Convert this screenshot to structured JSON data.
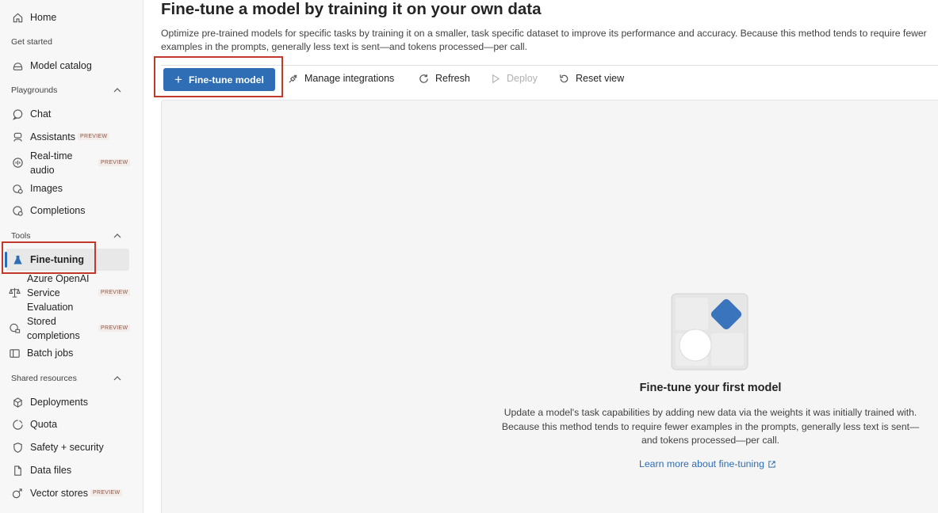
{
  "sidebar": {
    "home": "Home",
    "get_started": "Get started",
    "model_catalog": "Model catalog",
    "playgrounds": "Playgrounds",
    "chat": "Chat",
    "assistants": "Assistants",
    "realtime_line1": "Real-time",
    "realtime_line2": "audio",
    "images": "Images",
    "completions": "Completions",
    "tools": "Tools",
    "fine_tuning": "Fine-tuning",
    "eval_line1": "Azure OpenAI",
    "eval_line2": "Service",
    "eval_line3": "Evaluation",
    "stored_line1": "Stored",
    "stored_line2": "completions",
    "batch_jobs": "Batch jobs",
    "shared_resources": "Shared resources",
    "deployments": "Deployments",
    "quota": "Quota",
    "safety": "Safety + security",
    "data_files": "Data files",
    "vector_stores": "Vector stores",
    "preview_badge": "PREVIEW"
  },
  "main": {
    "title": "Fine-tune a model by training it on your own data",
    "subtitle": "Optimize pre-trained models for specific tasks by training it on a smaller, task specific dataset to improve its performance and accuracy. Because this method tends to require fewer examples in the prompts, generally less text is sent—and tokens processed—per call.",
    "toolbar": {
      "fine_tune": "Fine-tune model",
      "manage_integrations": "Manage integrations",
      "refresh": "Refresh",
      "deploy": "Deploy",
      "reset_view": "Reset view"
    },
    "empty": {
      "title": "Fine-tune your first model",
      "desc_line1": "Update a model's task capabilities by adding new data via the weights it was initially trained with.",
      "desc_line2": "Because this method tends to require fewer examples in the prompts, generally less text is sent—",
      "desc_line3": "and tokens processed—per call.",
      "link": "Learn more about fine-tuning"
    }
  },
  "colors": {
    "accent": "#2f6db4",
    "highlight": "#c0392b",
    "illus_diamond": "#3a74bd"
  },
  "icons": [
    "home-icon",
    "catalog-icon",
    "chevron-up-icon",
    "chat-icon",
    "assistants-icon",
    "audio-icon",
    "images-icon",
    "completions-icon",
    "flask-icon",
    "evaluation-icon",
    "stored-icon",
    "batch-icon",
    "deployments-icon",
    "quota-icon",
    "shield-icon",
    "file-icon",
    "vector-icon",
    "plus-icon",
    "plug-icon",
    "refresh-icon",
    "play-icon",
    "reset-icon",
    "external-link-icon"
  ]
}
